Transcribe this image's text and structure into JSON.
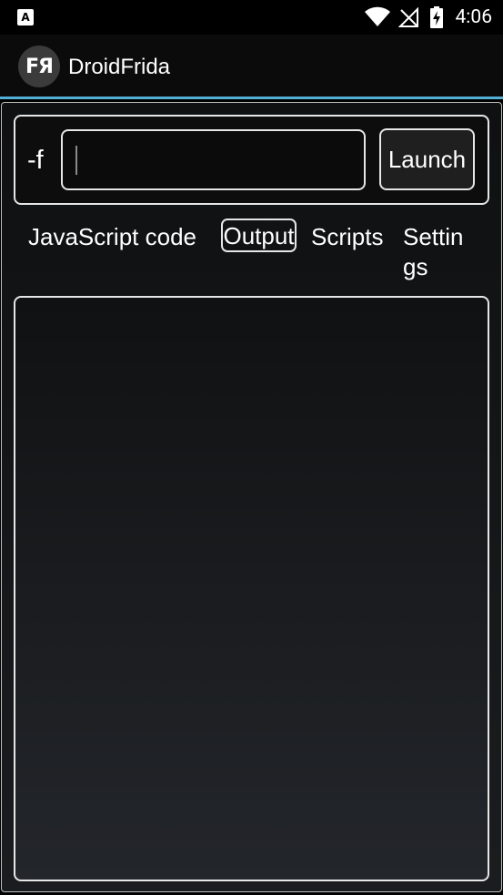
{
  "status_bar": {
    "left_icon_name": "a-notification-icon",
    "left_icon_letter": "A",
    "time": "4:06"
  },
  "app_bar": {
    "logo_text": "FЯ",
    "title": "DroidFrida",
    "accent_color": "#52b0d6"
  },
  "launch": {
    "flag_label": "-f",
    "input_value": "",
    "button_label": "Launch"
  },
  "tabs": [
    {
      "label": "JavaScript code",
      "selected": false
    },
    {
      "label": "Output",
      "selected": true
    },
    {
      "label": "Scripts",
      "selected": false
    },
    {
      "label": "Settings",
      "selected": false
    }
  ],
  "output": {
    "text": ""
  }
}
